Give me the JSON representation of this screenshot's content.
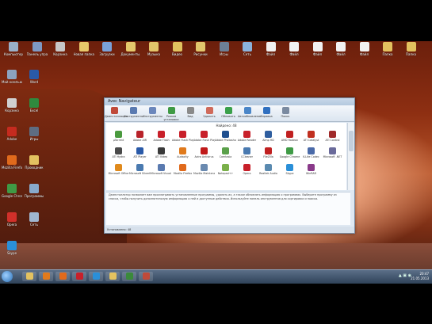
{
  "desktop_icons_top": [
    {
      "label": "Компьютер",
      "color": "#9ab0c8"
    },
    {
      "label": "Панель управления",
      "color": "#7e99c4"
    },
    {
      "label": "Корзина",
      "color": "#c7c7c7"
    },
    {
      "label": "Новая папка",
      "color": "#e7c86a"
    },
    {
      "label": "Загрузки",
      "color": "#7aa1d8"
    },
    {
      "label": "Документы",
      "color": "#e5c86c"
    },
    {
      "label": "Музыка",
      "color": "#e2c46a"
    },
    {
      "label": "Видео",
      "color": "#e0c35f"
    },
    {
      "label": "Рисунки",
      "color": "#e1c66d"
    },
    {
      "label": "Игры",
      "color": "#6d7f95"
    },
    {
      "label": "Сеть",
      "color": "#8bb3dd"
    },
    {
      "label": "Файл",
      "color": "#f1f1f1"
    },
    {
      "label": "Файл",
      "color": "#f1f1f1"
    },
    {
      "label": "Файл",
      "color": "#f1f1f1"
    },
    {
      "label": "Файл",
      "color": "#f1f1f1"
    },
    {
      "label": "Файл",
      "color": "#f1f1f1"
    },
    {
      "label": "Папка",
      "color": "#e2c15f"
    },
    {
      "label": "Папка",
      "color": "#e2c15f"
    }
  ],
  "desktop_icons_left": [
    {
      "label": "Мой компьютер",
      "color": "#8ca2bf"
    },
    {
      "label": "Корзина",
      "color": "#d0d0d0"
    },
    {
      "label": "Adobe",
      "color": "#c52b1f"
    },
    {
      "label": "Mozilla Firefox",
      "color": "#e06a1c"
    },
    {
      "label": "Google Chrome",
      "color": "#3f9a45"
    },
    {
      "label": "Opera",
      "color": "#d0302a"
    },
    {
      "label": "Skype",
      "color": "#2a8fd8"
    },
    {
      "label": "Word",
      "color": "#2a5aa8"
    },
    {
      "label": "Excel",
      "color": "#2f8a3e"
    },
    {
      "label": "Игры",
      "color": "#5e6d82"
    },
    {
      "label": "Проводник",
      "color": "#e3c260"
    },
    {
      "label": "Программы",
      "color": "#88aacc"
    },
    {
      "label": "Сеть",
      "color": "#a0b6d0"
    }
  ],
  "window": {
    "title": "Avec Navigateur",
    "toolbar": [
      {
        "label": "Деинсталляция",
        "color": "#c04a3a"
      },
      {
        "label": "Инструменты",
        "color": "#5a7ab0"
      },
      {
        "label": "Инструменты",
        "color": "#6b87bc"
      },
      {
        "label": "Режим установки",
        "color": "#3f9a45"
      },
      {
        "label": "Вид",
        "color": "#8a8a8a"
      },
      {
        "label": "Удалить",
        "color": "#d06a5a"
      },
      {
        "label": "Обновить",
        "color": "#3aa04a"
      },
      {
        "label": "Автообновление",
        "color": "#4a86c8"
      },
      {
        "label": "Справка",
        "color": "#3070c0"
      },
      {
        "label": "Поиск",
        "color": "#7a8aa0"
      }
    ],
    "found_text": "Найдено: 48",
    "programs": [
      {
        "label": "μTorrent",
        "color": "#4a9a3e"
      },
      {
        "label": "Adobe AIR",
        "color": "#b8232a"
      },
      {
        "label": "Adobe Flash",
        "color": "#c8202a"
      },
      {
        "label": "Adobe Flash Player",
        "color": "#c8202a"
      },
      {
        "label": "Adobe Flash Player",
        "color": "#c8202a"
      },
      {
        "label": "Adobe Photoshop",
        "color": "#1f4f8f"
      },
      {
        "label": "Adobe Reader",
        "color": "#c8202a"
      },
      {
        "label": "Aimp HD",
        "color": "#2f5e9f"
      },
      {
        "label": "AMD Radeon",
        "color": "#c02020"
      },
      {
        "label": "ATI Catalyst",
        "color": "#c03020"
      },
      {
        "label": "ATI Control",
        "color": "#a02a2a"
      },
      {
        "label": "ATI Hydra",
        "color": "#4a4a4a"
      },
      {
        "label": "ATI Player",
        "color": "#2a5aa8"
      },
      {
        "label": "ATI Video",
        "color": "#3a3a3a"
      },
      {
        "label": "Audacity",
        "color": "#e07a1c"
      },
      {
        "label": "Avira Antivirus",
        "color": "#c01a1a"
      },
      {
        "label": "Camtasia",
        "color": "#5aa04a"
      },
      {
        "label": "CCleaner",
        "color": "#4a7ab0"
      },
      {
        "label": "FileZilla",
        "color": "#c02020"
      },
      {
        "label": "Google Chrome",
        "color": "#3f9a45"
      },
      {
        "label": "K-Lite Codec",
        "color": "#4a6aa8"
      },
      {
        "label": "Microsoft .NET",
        "color": "#6a6a9a"
      },
      {
        "label": "Microsoft Office",
        "color": "#e08a1c"
      },
      {
        "label": "Microsoft Silverlight",
        "color": "#4a7ab0"
      },
      {
        "label": "Microsoft Visual C++",
        "color": "#5a7ab0"
      },
      {
        "label": "Mozilla Firefox",
        "color": "#e06a1c"
      },
      {
        "label": "Mozilla Maintenance",
        "color": "#6a8ab0"
      },
      {
        "label": "Notepad++",
        "color": "#7ab04a"
      },
      {
        "label": "Opera",
        "color": "#c8202a"
      },
      {
        "label": "Realtek Audio",
        "color": "#5a8ab0"
      },
      {
        "label": "Skype",
        "color": "#2a8fd8"
      },
      {
        "label": "WinRAR",
        "color": "#8a3a8a"
      }
    ],
    "description": "Деинсталлятор позволяет вам просматривать установленные программы, удалять их, а также обновлять информацию о программах. Выберите программу из списка, чтобы получить дополнительную информацию о ней и доступные действия. Используйте панель инструментов для сортировки и поиска.",
    "status": "Установлено: 48"
  },
  "taskbar": {
    "buttons": [
      {
        "name": "explorer",
        "color": "#e3c260"
      },
      {
        "name": "media-player",
        "color": "#e07a1c"
      },
      {
        "name": "firefox",
        "color": "#e06a1c"
      },
      {
        "name": "opera",
        "color": "#c8202a"
      },
      {
        "name": "skype",
        "color": "#2a8fd8"
      },
      {
        "name": "folder",
        "color": "#e3c260"
      },
      {
        "name": "terminal",
        "color": "#3a8a3a"
      },
      {
        "name": "uninstaller",
        "color": "#c04a3a"
      }
    ],
    "time": "20:47",
    "date": "21.05.2013"
  }
}
